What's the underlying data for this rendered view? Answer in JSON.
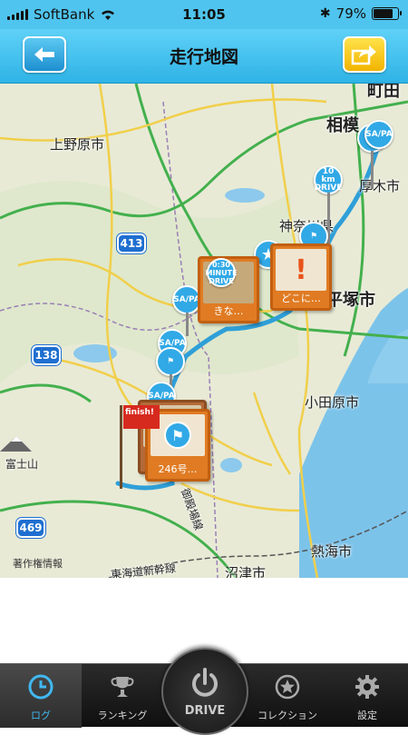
{
  "status": {
    "carrier": "SoftBank",
    "time": "11:05",
    "battery": "79%",
    "battery_level": 0.79
  },
  "nav": {
    "title": "走行地図",
    "back_icon": "back-arrow-icon",
    "share_icon": "share-icon"
  },
  "map": {
    "labels": {
      "machida": "町田",
      "sagami": "相模",
      "atsugi": "厚木市",
      "uenohara": "上野原市",
      "kanagawa": "神奈川県",
      "hiratsuka": "平塚市",
      "odawara": "小田原市",
      "fuji": "富士山",
      "atami": "熱海市",
      "numazu": "沼津市",
      "tokaido": "東海道新幹線",
      "gotemba": "御殿場線"
    },
    "routes": {
      "r413": "413",
      "r138": "138",
      "r469": "469"
    },
    "copyright": "著作権情報",
    "markers": {
      "ten_km": "10 km DRIVE",
      "thirty_min": "0:30 MINUTE DRIVE",
      "sapa": "SA/PA",
      "finish": "finish!",
      "board1_caption": "きな…",
      "board2_caption": "どこに…",
      "board3_caption": "246号…"
    }
  },
  "tabs": [
    {
      "label": "ログ",
      "icon": "clock-icon",
      "active": true
    },
    {
      "label": "ランキング",
      "icon": "trophy-icon",
      "active": false
    },
    {
      "label": "DRIVE",
      "icon": "power-icon",
      "active": false
    },
    {
      "label": "コレクション",
      "icon": "star-badge-icon",
      "active": false
    },
    {
      "label": "設定",
      "icon": "gear-icon",
      "active": false
    }
  ],
  "colors": {
    "accent": "#41b8f0",
    "nav_bar": "#2fb3e6",
    "route": "#2f9fd8",
    "sea": "#7cc3ea",
    "board": "#e07b23"
  }
}
